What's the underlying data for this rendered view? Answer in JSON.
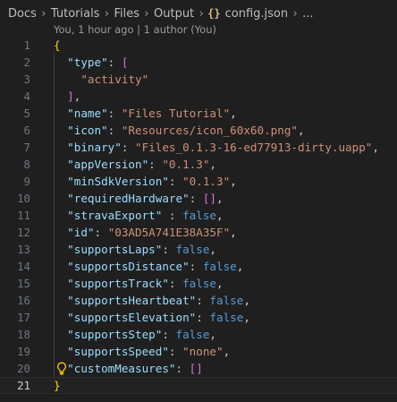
{
  "breadcrumb": {
    "items": [
      "Docs",
      "Tutorials",
      "Files",
      "Output"
    ],
    "file_icon": "{}",
    "file_name": "config.json",
    "ellipsis": "..."
  },
  "codelens": "You, 1 hour ago | 1 author (You)",
  "editor": {
    "current_line": 21,
    "lines": [
      {
        "n": "1"
      },
      {
        "n": "2"
      },
      {
        "n": "3"
      },
      {
        "n": "4"
      },
      {
        "n": "5"
      },
      {
        "n": "6"
      },
      {
        "n": "7"
      },
      {
        "n": "8"
      },
      {
        "n": "9"
      },
      {
        "n": "10"
      },
      {
        "n": "11"
      },
      {
        "n": "12"
      },
      {
        "n": "13"
      },
      {
        "n": "14"
      },
      {
        "n": "15"
      },
      {
        "n": "16"
      },
      {
        "n": "17"
      },
      {
        "n": "18"
      },
      {
        "n": "19"
      },
      {
        "n": "20"
      },
      {
        "n": "21"
      }
    ],
    "type_key": "\"type\"",
    "type_value": "\"activity\"",
    "name_key": "\"name\"",
    "name_value": "\"Files Tutorial\"",
    "icon_key": "\"icon\"",
    "icon_value": "\"Resources/icon_60x60.png\"",
    "binary_key": "\"binary\"",
    "binary_value": "\"Files_0.1.3-16-ed77913-dirty.uapp\"",
    "appVersion_key": "\"appVersion\"",
    "appVersion_value": "\"0.1.3\"",
    "minSdkVersion_key": "\"minSdkVersion\"",
    "minSdkVersion_value": "\"0.1.3\"",
    "requiredHardware_key": "\"requiredHardware\"",
    "stravaExport_key": "\"stravaExport\"",
    "stravaExport_value": "false",
    "id_key": "\"id\"",
    "id_value": "\"03AD5A741E38A35F\"",
    "supportsLaps_key": "\"supportsLaps\"",
    "supportsLaps_value": "false",
    "supportsDistance_key": "\"supportsDistance\"",
    "supportsDistance_value": "false",
    "supportsTrack_key": "\"supportsTrack\"",
    "supportsTrack_value": "false",
    "supportsHeartbeat_key": "\"supportsHeartbeat\"",
    "supportsHeartbeat_value": "false",
    "supportsElevation_key": "\"supportsElevation\"",
    "supportsElevation_value": "false",
    "supportsStep_key": "\"supportsStep\"",
    "supportsStep_value": "false",
    "supportsSpeed_key": "\"supportsSpeed\"",
    "supportsSpeed_value": "\"none\"",
    "customMeasures_key": "\"customMeasures\""
  },
  "colors": {
    "background": "#1f1f1f",
    "key": "#9cdcfe",
    "string": "#ce9178",
    "keyword": "#569cd6",
    "bracket_outer": "#ffd700",
    "bracket_inner": "#da70d6",
    "lightbulb": "#ffcc00"
  },
  "icons": {
    "file_type": "json-braces-icon",
    "separator": "chevron-right-icon",
    "gutter": "lightbulb-icon"
  }
}
